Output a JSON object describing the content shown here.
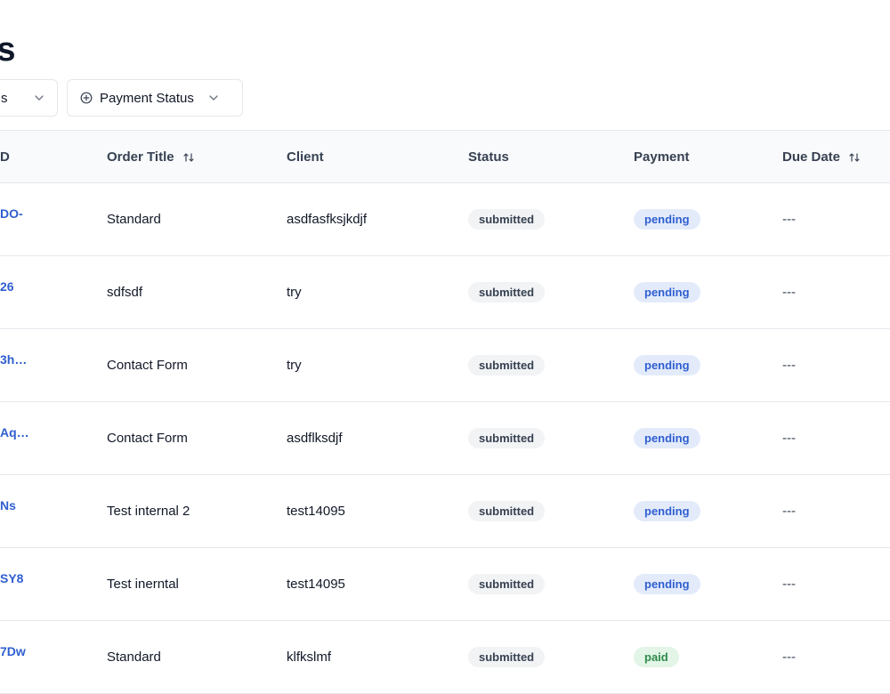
{
  "page": {
    "title": "ers"
  },
  "filters": {
    "first": {
      "label": "s"
    },
    "payment_status": {
      "label": "Payment Status"
    }
  },
  "table": {
    "columns": {
      "id": "D",
      "title": "Order Title",
      "client": "Client",
      "status": "Status",
      "payment": "Payment",
      "due_date": "Due Date"
    },
    "rows": [
      {
        "id": "DO-",
        "title": "Standard",
        "client": "asdfasfksjkdjf",
        "status": "submitted",
        "payment": "pending",
        "due": "---"
      },
      {
        "id": "26",
        "title": "sdfsdf",
        "client": "try",
        "status": "submitted",
        "payment": "pending",
        "due": "---"
      },
      {
        "id": "3h…",
        "title": "Contact Form",
        "client": "try",
        "status": "submitted",
        "payment": "pending",
        "due": "---"
      },
      {
        "id": "Aq…",
        "title": "Contact Form",
        "client": "asdflksdjf",
        "status": "submitted",
        "payment": "pending",
        "due": "---"
      },
      {
        "id": "Ns",
        "title": "Test internal 2",
        "client": "test14095",
        "status": "submitted",
        "payment": "pending",
        "due": "---"
      },
      {
        "id": "SY8",
        "title": "Test inerntal",
        "client": "test14095",
        "status": "submitted",
        "payment": "pending",
        "due": "---"
      },
      {
        "id": "7Dw",
        "title": "Standard",
        "client": "klfkslmf",
        "status": "submitted",
        "payment": "paid",
        "due": "---"
      }
    ]
  },
  "icons": {
    "chevron": "chevron-down-icon",
    "plus": "plus-circle-icon",
    "sort": "sort-icon"
  },
  "colors": {
    "link": "#2f5fd0",
    "pending_bg": "#e3ebfb",
    "paid_bg": "#e2f5e7",
    "paid_text": "#2f8a4a"
  }
}
